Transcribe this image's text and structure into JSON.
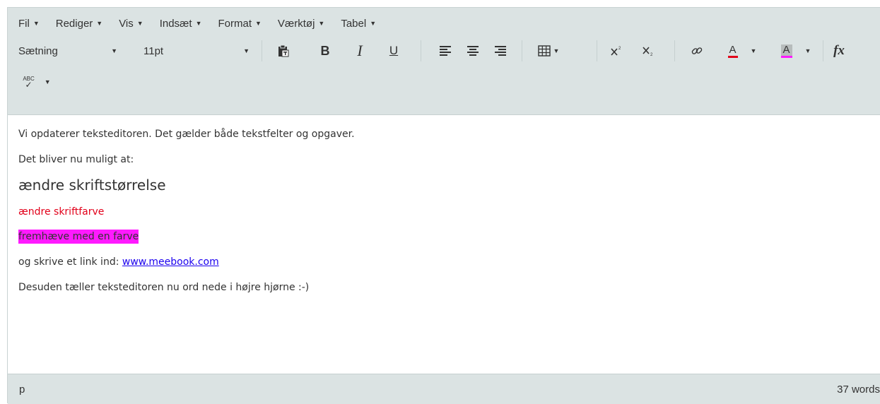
{
  "menubar": {
    "items": [
      {
        "label": "Fil"
      },
      {
        "label": "Rediger"
      },
      {
        "label": "Vis"
      },
      {
        "label": "Indsæt"
      },
      {
        "label": "Format"
      },
      {
        "label": "Værktøj"
      },
      {
        "label": "Tabel"
      }
    ]
  },
  "toolbar": {
    "block_format": "Sætning",
    "font_size": "11pt",
    "icons": [
      "paste-text-icon",
      "bold-icon",
      "italic-icon",
      "underline-icon",
      "align-left-icon",
      "align-center-icon",
      "align-right-icon",
      "table-icon",
      "superscript-icon",
      "subscript-icon",
      "link-icon",
      "text-color-icon",
      "background-color-icon",
      "clear-formatting-icon",
      "spellcheck-icon"
    ],
    "bold_label": "B",
    "italic_label": "I",
    "underline_label": "U",
    "text_color_label": "A",
    "bg_color_label": "A",
    "clear_format_label": "fx",
    "spellcheck_label": "ABC",
    "text_color": "#e2001a",
    "highlight_color": "#ff1aff"
  },
  "content": {
    "line1": "Vi opdaterer teksteditoren. Det gælder både tekstfelter og opgaver.",
    "line2": "Det bliver nu muligt at:",
    "line3": "ændre skriftstørrelse",
    "line4": "ændre skriftfarve",
    "line5": "fremhæve med en farve",
    "line6_prefix": "og skrive et link ind: ",
    "line6_link": "www.meebook.com",
    "line7": "Desuden tæller teksteditoren nu ord nede i højre hjørne :-)"
  },
  "statusbar": {
    "path": "p",
    "word_count": "37 words"
  }
}
